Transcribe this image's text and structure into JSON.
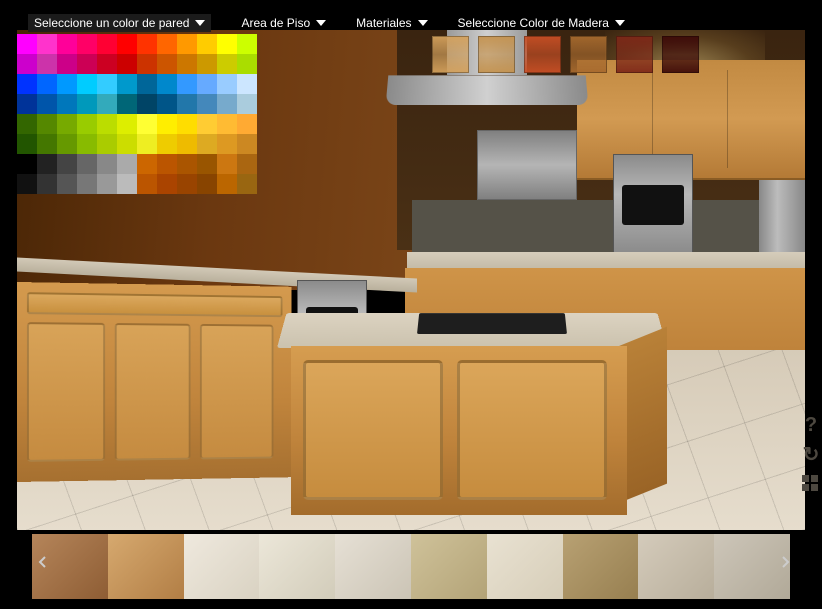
{
  "menu": {
    "wall_color": "Seleccione un color de pared",
    "floor_area": "Area de Piso",
    "materials": "Materiales",
    "wood_color": "Seleccione Color de Madera"
  },
  "color_palette_rows": [
    [
      "#ff00ff",
      "#ff33cc",
      "#ff0099",
      "#ff0066",
      "#ff0033",
      "#ff0000",
      "#ff3300",
      "#ff6600",
      "#ff9900",
      "#ffcc00",
      "#ffff00",
      "#ccff00"
    ],
    [
      "#cc00cc",
      "#cc33aa",
      "#cc0088",
      "#cc0055",
      "#cc0022",
      "#cc0000",
      "#cc3300",
      "#cc5500",
      "#cc7700",
      "#cc9900",
      "#cccc00",
      "#aadd00"
    ],
    [
      "#0033ff",
      "#0066ff",
      "#0099ff",
      "#00ccff",
      "#33ccff",
      "#0099cc",
      "#006699",
      "#0088cc",
      "#3399ff",
      "#66aaff",
      "#99ccff",
      "#cce6ff"
    ],
    [
      "#003399",
      "#0055aa",
      "#0077bb",
      "#0099bb",
      "#33aabb",
      "#006677",
      "#004466",
      "#005588",
      "#2277aa",
      "#4488bb",
      "#77aacc",
      "#aaccdd"
    ],
    [
      "#336600",
      "#558800",
      "#77aa00",
      "#99cc00",
      "#bbdd00",
      "#ddee00",
      "#ffff33",
      "#ffee00",
      "#ffdd00",
      "#ffcc33",
      "#ffbb33",
      "#ffaa33"
    ],
    [
      "#225500",
      "#447700",
      "#669900",
      "#88bb00",
      "#aacc00",
      "#ccdd00",
      "#eeee22",
      "#eecc00",
      "#eebb00",
      "#ddaa22",
      "#dd9922",
      "#cc8822"
    ],
    [
      "#000000",
      "#222222",
      "#444444",
      "#666666",
      "#888888",
      "#aaaaaa",
      "#cc6600",
      "#bb5500",
      "#aa5500",
      "#995500",
      "#cc7711",
      "#aa6611"
    ],
    [
      "#111111",
      "#333333",
      "#555555",
      "#777777",
      "#999999",
      "#bbbbbb",
      "#bb5500",
      "#aa4400",
      "#994400",
      "#884400",
      "#bb6600",
      "#996611"
    ]
  ],
  "wood_colors": [
    {
      "name": "light-oak",
      "color": "#d4a15c"
    },
    {
      "name": "natural-oak",
      "color": "#c4924e"
    },
    {
      "name": "red-oak",
      "color": "#c94f25"
    },
    {
      "name": "medium-wood",
      "color": "#a76a2e"
    },
    {
      "name": "cherry",
      "color": "#7e2818"
    },
    {
      "name": "mahogany",
      "color": "#3d0a08"
    }
  ],
  "scene": {
    "wall_color": "#6b3810",
    "wood_finish": "natural-oak",
    "countertop": "#d2c9b7",
    "floor": "beige-tile"
  },
  "thumbnails": [
    {
      "name": "tile-1",
      "gradient": "linear-gradient(135deg,#b5855a,#8e5d34)"
    },
    {
      "name": "tile-2",
      "gradient": "linear-gradient(135deg,#d6a96f,#b27e45)"
    },
    {
      "name": "tile-3",
      "gradient": "linear-gradient(135deg,#efe9de,#d9d2c2)"
    },
    {
      "name": "tile-4",
      "gradient": "linear-gradient(135deg,#ece7d9,#d2ccba)"
    },
    {
      "name": "tile-5",
      "gradient": "linear-gradient(135deg,#e6e0d5,#cbc4b5)"
    },
    {
      "name": "tile-6",
      "gradient": "linear-gradient(135deg,#cfc29a,#b3a377)"
    },
    {
      "name": "tile-7",
      "gradient": "linear-gradient(135deg,#e9e2d2,#d6cdb8)"
    },
    {
      "name": "tile-8",
      "gradient": "linear-gradient(135deg,#b8a173,#977f50)"
    },
    {
      "name": "tile-9",
      "gradient": "linear-gradient(135deg,#d4cbbb,#b8ae9b)"
    },
    {
      "name": "tile-10",
      "gradient": "linear-gradient(135deg,#cdc6b9,#b1a998)"
    }
  ],
  "side_icons": {
    "help": "?",
    "refresh": "↻"
  }
}
